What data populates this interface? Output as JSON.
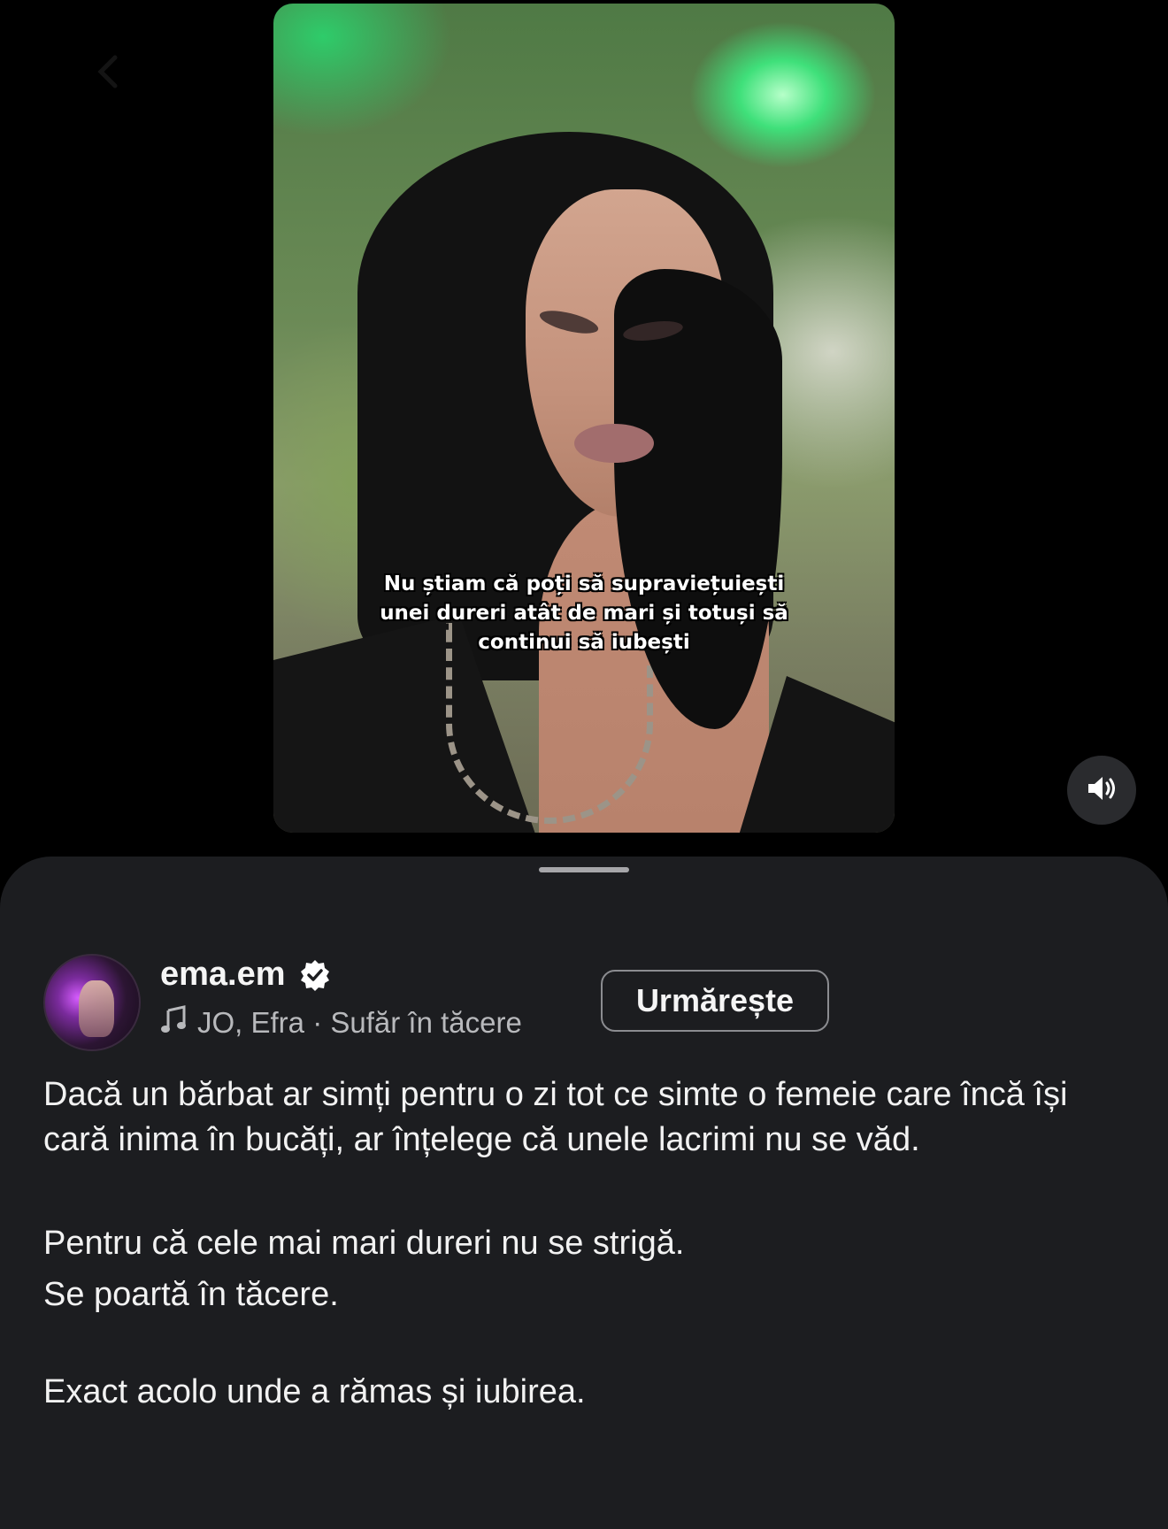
{
  "video": {
    "caption_lines": [
      "Nu știam că poți să supraviețuiești",
      "unei dureri atât de mari și totuși să",
      "continui să iubești"
    ],
    "sound_icon": "speaker-volume-icon",
    "back_icon": "chevron-left-icon"
  },
  "post": {
    "username": "ema.em",
    "verified_icon": "verified-badge-icon",
    "audio": "JO, Efra · Sufăr în tăcere",
    "audio_icon": "music-note-icon",
    "follow_label": "Urmărește",
    "paragraphs": [
      "Dacă un bărbat ar simți pentru o zi tot ce simte o femeie care încă își cară inima în bucăți, ar înțelege că unele lacrimi nu se văd.",
      "Pentru că cele mai mari dureri nu se strigă.",
      "Se poartă în tăcere.",
      "Exact acolo unde a rămas și iubirea."
    ]
  },
  "colors": {
    "background": "#000000",
    "sheet": "#1c1d20",
    "text_primary": "#f5f5f5",
    "text_secondary": "#b8b9bc",
    "button_border": "#8b8c90"
  }
}
